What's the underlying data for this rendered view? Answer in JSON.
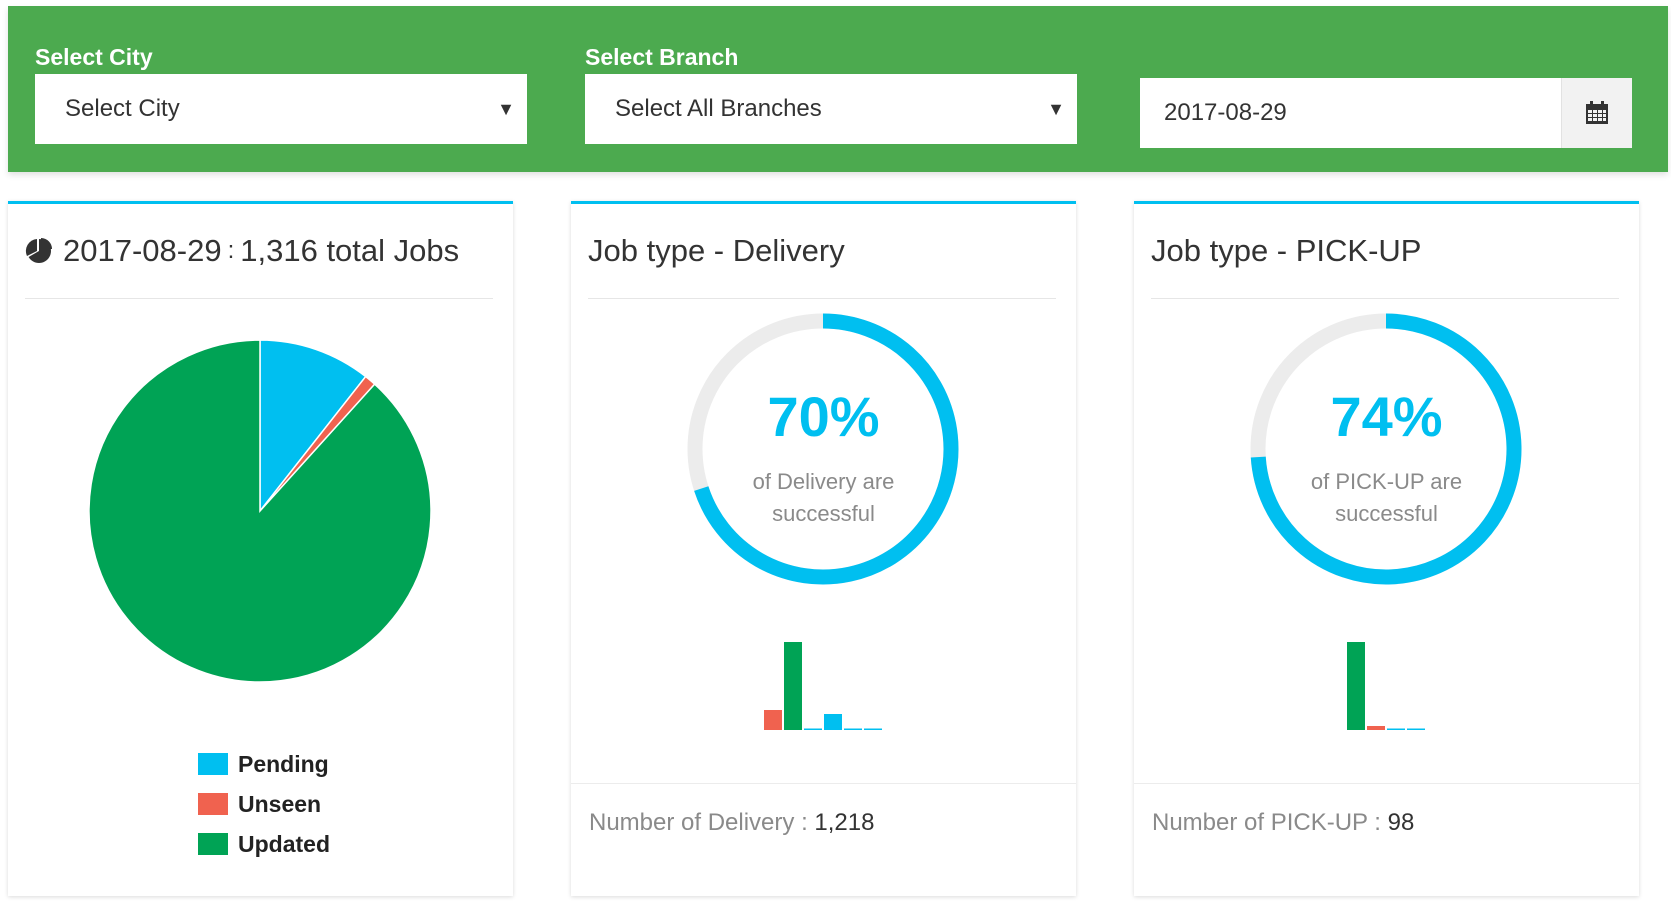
{
  "filters": {
    "city": {
      "label": "Select City",
      "value": "Select City"
    },
    "branch": {
      "label": "Select Branch",
      "value": "Select All Branches"
    },
    "date": {
      "value": "2017-08-29",
      "icon": "calendar-icon"
    }
  },
  "summary_card": {
    "date": "2017-08-29",
    "separator": ":",
    "total_text": "1,316 total Jobs",
    "icon": "pie-chart-icon"
  },
  "delivery_card": {
    "title": "Job type - Delivery",
    "percent": "70%",
    "line1": "of Delivery are",
    "line2": "successful",
    "footer_label": "Number of Delivery :",
    "footer_count": "1,218"
  },
  "pickup_card": {
    "title": "Job type - PICK-UP",
    "percent": "74%",
    "line1": "of PICK-UP are",
    "line2": "successful",
    "footer_label": "Number of PICK-UP :",
    "footer_count": "98"
  },
  "colors": {
    "header_green": "#4caa4f",
    "accent_blue": "#00bff0",
    "pending": "#00bff0",
    "unseen": "#f0624f",
    "updated": "#00a355",
    "track": "#ececec"
  },
  "chart_data": [
    {
      "type": "pie",
      "categories": [
        "Pending",
        "Unseen",
        "Updated"
      ],
      "values": [
        0.106,
        0.011,
        0.883
      ],
      "colors": [
        "#00bff0",
        "#f0624f",
        "#00a355"
      ],
      "legend": "bottom"
    },
    {
      "type": "gauge",
      "value": 0.7,
      "color": "#00bff0"
    },
    {
      "type": "bar",
      "values": [
        5,
        22,
        0,
        4,
        0,
        0
      ],
      "colors": [
        "#f0624f",
        "#00a355",
        "#00bff0",
        "#00bff0",
        "#00bff0",
        "#00bff0"
      ]
    },
    {
      "type": "gauge",
      "value": 0.74,
      "color": "#00bff0"
    },
    {
      "type": "bar",
      "values": [
        22,
        1,
        0,
        0
      ],
      "colors": [
        "#00a355",
        "#f0624f",
        "#00bff0",
        "#00bff0"
      ]
    }
  ]
}
